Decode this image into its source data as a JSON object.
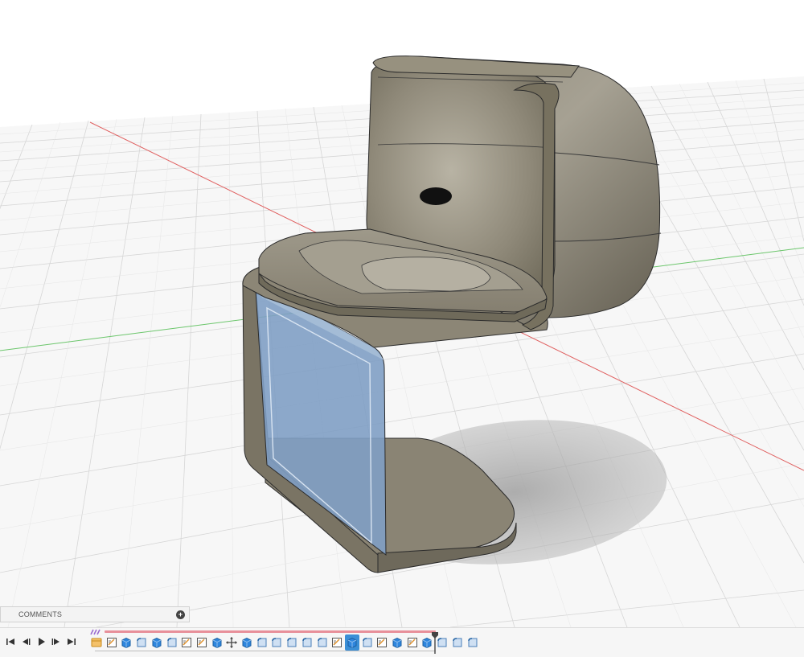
{
  "comments_panel": {
    "label": "COMMENTS",
    "add_icon": "plus-circle-icon"
  },
  "playback": [
    {
      "name": "go-to-start",
      "icon": "skip-start-icon"
    },
    {
      "name": "step-back",
      "icon": "step-back-icon"
    },
    {
      "name": "play",
      "icon": "play-icon"
    },
    {
      "name": "step-forward",
      "icon": "step-forward-icon"
    },
    {
      "name": "go-to-end",
      "icon": "skip-end-icon"
    }
  ],
  "timeline": {
    "features": [
      "component",
      "sketch",
      "extrude",
      "fillet",
      "extrude",
      "fillet",
      "sketch",
      "sketch",
      "extrude",
      "move",
      "extrude",
      "fillet",
      "fillet",
      "fillet",
      "fillet",
      "fillet",
      "sketch",
      "extrude",
      "fillet",
      "sketch",
      "extrude",
      "sketch",
      "extrude",
      "fillet",
      "fillet",
      "fillet"
    ],
    "selected_index": 17
  },
  "colors": {
    "accent_selected": "#3b8fd6",
    "feature_blue": "#2e86de",
    "timeline_bar": "#e8909a",
    "model_body": "#8f8878",
    "selected_face": "#7f9fc4",
    "grid_line": "#d4d4d4",
    "axis_x": "#e06060",
    "axis_z": "#6cc66c"
  }
}
